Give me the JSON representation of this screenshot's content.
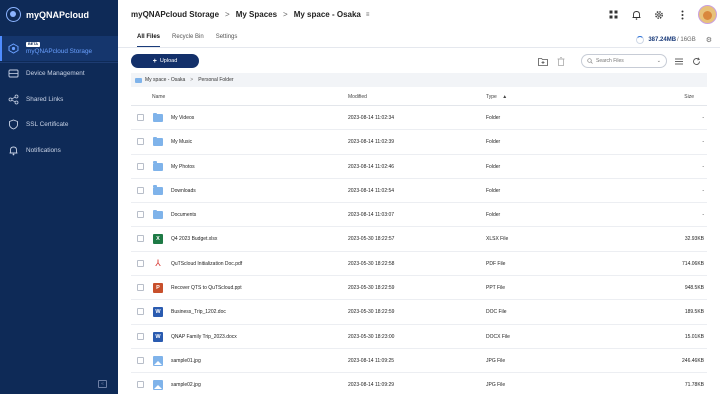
{
  "sidebar": {
    "brand": "myQNAPcloud",
    "items": [
      {
        "label": "myQNAPcloud Storage",
        "badge": "BETA",
        "icon": "storage-icon"
      },
      {
        "label": "Device Management",
        "icon": "device-icon"
      },
      {
        "label": "Shared Links",
        "icon": "share-icon"
      },
      {
        "label": "SSL Certificate",
        "icon": "certificate-icon"
      },
      {
        "label": "Notifications",
        "icon": "bell-icon"
      }
    ]
  },
  "header": {
    "crumbs": [
      "myQNAPcloud Storage",
      "My Spaces",
      "My space - Osaka"
    ],
    "sep": ">"
  },
  "tabs": [
    "All Files",
    "Recycle Bin",
    "Settings"
  ],
  "storage": {
    "used": "387.24MB",
    "total": "/ 16GB"
  },
  "toolbar": {
    "upload_label": "Upload",
    "search_placeholder": "Search Files"
  },
  "path": [
    "My space - Osaka",
    "Personal Folder"
  ],
  "columns": {
    "name": "Name",
    "modified": "Modified",
    "type": "Type",
    "sort": "▲",
    "size": "Size"
  },
  "files": [
    {
      "name": "My Videos",
      "modified": "2023-08-14 11:02:34",
      "type": "Folder",
      "size": "-",
      "kind": "folder"
    },
    {
      "name": "My Music",
      "modified": "2023-08-14 11:02:39",
      "type": "Folder",
      "size": "-",
      "kind": "folder"
    },
    {
      "name": "My Photos",
      "modified": "2023-08-14 11:02:46",
      "type": "Folder",
      "size": "-",
      "kind": "folder"
    },
    {
      "name": "Downloads",
      "modified": "2023-08-14 11:02:54",
      "type": "Folder",
      "size": "-",
      "kind": "folder"
    },
    {
      "name": "Documents",
      "modified": "2023-08-14 11:03:07",
      "type": "Folder",
      "size": "-",
      "kind": "folder"
    },
    {
      "name": "Q4 2023 Budget.xlsx",
      "modified": "2023-05-30 18:22:57",
      "type": "XLSX File",
      "size": "32.93KB",
      "kind": "xlsx",
      "glyph": "X"
    },
    {
      "name": "QuTScloud Initialization Doc.pdf",
      "modified": "2023-05-30 18:22:58",
      "type": "PDF File",
      "size": "714.06KB",
      "kind": "pdf",
      "glyph": "⅄"
    },
    {
      "name": "Recover QTS to QuTScloud.ppt",
      "modified": "2023-05-30 18:22:59",
      "type": "PPT File",
      "size": "948.5KB",
      "kind": "ppt",
      "glyph": "P"
    },
    {
      "name": "Business_Trip_1202.doc",
      "modified": "2023-05-30 18:22:59",
      "type": "DOC File",
      "size": "189.5KB",
      "kind": "doc",
      "glyph": "W"
    },
    {
      "name": "QNAP Family Trip_2023.docx",
      "modified": "2023-05-30 18:23:00",
      "type": "DOCX File",
      "size": "15.01KB",
      "kind": "doc",
      "glyph": "W"
    },
    {
      "name": "sample01.jpg",
      "modified": "2023-08-14 11:09:25",
      "type": "JPG File",
      "size": "246.46KB",
      "kind": "jpg"
    },
    {
      "name": "sample02.jpg",
      "modified": "2023-08-14 11:09:29",
      "type": "JPG File",
      "size": "71.78KB",
      "kind": "jpg"
    }
  ]
}
